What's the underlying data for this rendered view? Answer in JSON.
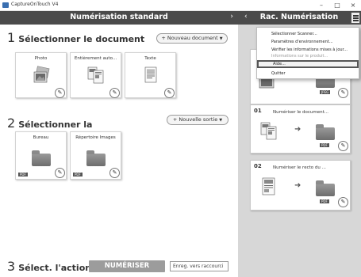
{
  "window": {
    "title": "CaptureOnTouch V4",
    "minimize": "–",
    "maximize": "□",
    "close": "×"
  },
  "main": {
    "header_title": "Numérisation standard",
    "header_chevron": "›",
    "section1": {
      "number": "1",
      "title": "Sélectionner le document",
      "new_button": "+ Nouveau document",
      "cards": [
        {
          "label": "Photo",
          "icon": "photo-icon"
        },
        {
          "label": "Entièrement auto...",
          "icon": "auto-documents-icon"
        },
        {
          "label": "Texte",
          "icon": "text-document-icon"
        }
      ]
    },
    "section2": {
      "number": "2",
      "title": "Sélectionner la",
      "new_button": "+ Nouvelle sortie",
      "cards": [
        {
          "label": "Bureau",
          "tag": "PDF",
          "icon": "folder-icon"
        },
        {
          "label": "Répertoire Images",
          "tag": "PDF",
          "icon": "folder-icon"
        }
      ]
    },
    "section3": {
      "number": "3",
      "title": "Sélect. l'action",
      "scan_button": "NUMÉRISER",
      "shortcut_button": "Enreg. vers raccourci"
    }
  },
  "right": {
    "header_title": "Rac. Numérisation",
    "header_chevron": "‹",
    "menu": {
      "items": [
        "Sélectionner Scanner...",
        "Paramètres d'environnement...",
        "Vérifier les informations mises à jour...",
        "Informations sur le produit...",
        "Aide...",
        "Quitter"
      ],
      "highlighted_index": 4
    },
    "cards": [
      {
        "number": "",
        "title": "",
        "tag": "JPEG"
      },
      {
        "number": "01",
        "title": "Numériser le document...",
        "tag": "PDF"
      },
      {
        "number": "02",
        "title": "Numériser le recto du ...",
        "tag": "PDF"
      }
    ]
  },
  "edit_glyph": "✎",
  "arrow_glyph": "➜",
  "caret_glyph": "▼",
  "colors": {
    "header_bg": "#4b4b4b",
    "side_bg": "#d7d7d7",
    "scan_button": "#9c9c9c"
  }
}
